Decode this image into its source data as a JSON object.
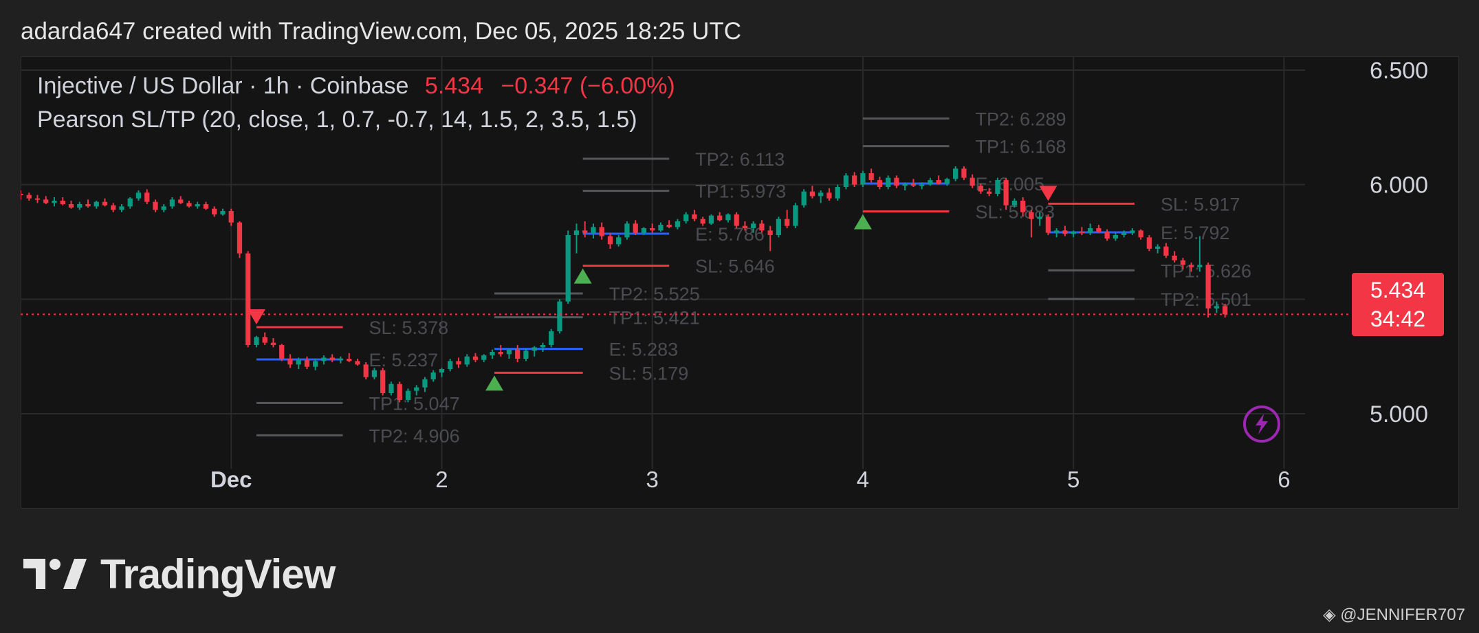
{
  "header": {
    "title": "adarda647 created with TradingView.com, Dec 05, 2025 18:25 UTC"
  },
  "legend": {
    "symbol": "Injective / US Dollar · 1h · Coinbase",
    "price": "5.434",
    "change": "−0.347 (−6.00%)",
    "indicator": "Pearson SL/TP (20, close, 1, 0.7, -0.7, 14, 1.5, 2, 3.5, 1.5)"
  },
  "price_badge": {
    "price": "5.434",
    "countdown": "34:42"
  },
  "brand": {
    "name": "TradingView"
  },
  "credit": {
    "text": "@JENNIFER707"
  },
  "colors": {
    "up": "#089981",
    "down": "#f23645",
    "entry": "#2962ff",
    "sl": "#f23645",
    "tp": "#55575d",
    "label": "#4a4c52",
    "current_price": "#f23645"
  },
  "chart_data": {
    "type": "candlestick",
    "x_axis": {
      "ticks": [
        "Dec",
        "2",
        "3",
        "4",
        "5",
        "6"
      ],
      "tick_positions_days": [
        1,
        2,
        3,
        4,
        5,
        6
      ]
    },
    "y_axis": {
      "ticks": [
        5.0,
        5.5,
        6.0,
        6.5
      ],
      "tick_labels": [
        "5.000",
        "5.500",
        "6.000",
        "6.500"
      ],
      "range": [
        4.76,
        6.56
      ],
      "side": "right"
    },
    "current_price": 5.434,
    "x_range_days": [
      0.0,
      6.1
    ],
    "candles": [
      [
        0.0,
        5.96,
        5.975,
        5.935,
        5.955
      ],
      [
        0.04,
        5.955,
        5.965,
        5.93,
        5.94
      ],
      [
        0.08,
        5.94,
        5.955,
        5.92,
        5.935
      ],
      [
        0.12,
        5.935,
        5.95,
        5.915,
        5.92
      ],
      [
        0.16,
        5.92,
        5.945,
        5.905,
        5.93
      ],
      [
        0.2,
        5.93,
        5.945,
        5.91,
        5.915
      ],
      [
        0.24,
        5.915,
        5.93,
        5.895,
        5.9
      ],
      [
        0.28,
        5.9,
        5.925,
        5.89,
        5.915
      ],
      [
        0.32,
        5.915,
        5.935,
        5.9,
        5.905
      ],
      [
        0.36,
        5.905,
        5.93,
        5.895,
        5.925
      ],
      [
        0.4,
        5.925,
        5.94,
        5.905,
        5.91
      ],
      [
        0.44,
        5.91,
        5.92,
        5.88,
        5.89
      ],
      [
        0.48,
        5.89,
        5.915,
        5.88,
        5.905
      ],
      [
        0.52,
        5.905,
        5.945,
        5.895,
        5.94
      ],
      [
        0.56,
        5.94,
        5.975,
        5.93,
        5.965
      ],
      [
        0.6,
        5.965,
        5.98,
        5.915,
        5.925
      ],
      [
        0.64,
        5.925,
        5.935,
        5.88,
        5.89
      ],
      [
        0.68,
        5.89,
        5.915,
        5.88,
        5.905
      ],
      [
        0.72,
        5.905,
        5.945,
        5.895,
        5.935
      ],
      [
        0.76,
        5.935,
        5.95,
        5.915,
        5.92
      ],
      [
        0.8,
        5.92,
        5.93,
        5.9,
        5.905
      ],
      [
        0.84,
        5.905,
        5.925,
        5.895,
        5.915
      ],
      [
        0.88,
        5.915,
        5.925,
        5.89,
        5.895
      ],
      [
        0.92,
        5.895,
        5.905,
        5.86,
        5.87
      ],
      [
        0.96,
        5.87,
        5.895,
        5.865,
        5.885
      ],
      [
        1.0,
        5.885,
        5.895,
        5.82,
        5.835
      ],
      [
        1.04,
        5.835,
        5.84,
        5.68,
        5.7
      ],
      [
        1.08,
        5.7,
        5.71,
        5.29,
        5.3
      ],
      [
        1.12,
        5.3,
        5.34,
        5.29,
        5.335
      ],
      [
        1.16,
        5.335,
        5.355,
        5.3,
        5.31
      ],
      [
        1.2,
        5.31,
        5.33,
        5.29,
        5.3
      ],
      [
        1.24,
        5.3,
        5.305,
        5.23,
        5.24
      ],
      [
        1.28,
        5.24,
        5.26,
        5.2,
        5.215
      ],
      [
        1.32,
        5.215,
        5.245,
        5.195,
        5.235
      ],
      [
        1.36,
        5.235,
        5.25,
        5.195,
        5.205
      ],
      [
        1.4,
        5.205,
        5.24,
        5.19,
        5.23
      ],
      [
        1.44,
        5.23,
        5.255,
        5.215,
        5.245
      ],
      [
        1.48,
        5.245,
        5.26,
        5.225,
        5.235
      ],
      [
        1.52,
        5.235,
        5.25,
        5.22,
        5.24
      ],
      [
        1.56,
        5.24,
        5.265,
        5.225,
        5.23
      ],
      [
        1.6,
        5.23,
        5.24,
        5.21,
        5.215
      ],
      [
        1.64,
        5.215,
        5.225,
        5.15,
        5.16
      ],
      [
        1.68,
        5.16,
        5.2,
        5.15,
        5.19
      ],
      [
        1.72,
        5.19,
        5.2,
        5.08,
        5.09
      ],
      [
        1.76,
        5.09,
        5.14,
        5.08,
        5.13
      ],
      [
        1.8,
        5.13,
        5.14,
        5.05,
        5.06
      ],
      [
        1.84,
        5.06,
        5.11,
        5.05,
        5.1
      ],
      [
        1.88,
        5.1,
        5.125,
        5.08,
        5.115
      ],
      [
        1.92,
        5.115,
        5.16,
        5.095,
        5.15
      ],
      [
        1.96,
        5.15,
        5.19,
        5.14,
        5.18
      ],
      [
        2.0,
        5.18,
        5.2,
        5.16,
        5.195
      ],
      [
        2.04,
        5.195,
        5.24,
        5.185,
        5.23
      ],
      [
        2.08,
        5.23,
        5.245,
        5.2,
        5.215
      ],
      [
        2.12,
        5.215,
        5.26,
        5.205,
        5.25
      ],
      [
        2.16,
        5.25,
        5.265,
        5.225,
        5.235
      ],
      [
        2.2,
        5.235,
        5.26,
        5.225,
        5.255
      ],
      [
        2.24,
        5.255,
        5.28,
        5.24,
        5.27
      ],
      [
        2.28,
        5.27,
        5.3,
        5.25,
        5.26
      ],
      [
        2.32,
        5.26,
        5.285,
        5.24,
        5.28
      ],
      [
        2.36,
        5.28,
        5.3,
        5.225,
        5.24
      ],
      [
        2.4,
        5.24,
        5.285,
        5.23,
        5.275
      ],
      [
        2.44,
        5.275,
        5.295,
        5.25,
        5.29
      ],
      [
        2.48,
        5.29,
        5.31,
        5.27,
        5.3
      ],
      [
        2.52,
        5.3,
        5.37,
        5.29,
        5.36
      ],
      [
        2.56,
        5.36,
        5.5,
        5.35,
        5.49
      ],
      [
        2.6,
        5.49,
        5.8,
        5.48,
        5.78
      ],
      [
        2.64,
        5.78,
        5.83,
        5.7,
        5.8
      ],
      [
        2.68,
        5.8,
        5.84,
        5.77,
        5.79
      ],
      [
        2.72,
        5.79,
        5.83,
        5.765,
        5.815
      ],
      [
        2.76,
        5.815,
        5.835,
        5.76,
        5.775
      ],
      [
        2.8,
        5.775,
        5.79,
        5.72,
        5.74
      ],
      [
        2.84,
        5.74,
        5.78,
        5.73,
        5.77
      ],
      [
        2.88,
        5.77,
        5.84,
        5.76,
        5.83
      ],
      [
        2.92,
        5.83,
        5.845,
        5.78,
        5.79
      ],
      [
        2.96,
        5.79,
        5.815,
        5.78,
        5.81
      ],
      [
        3.0,
        5.81,
        5.83,
        5.79,
        5.8
      ],
      [
        3.04,
        5.8,
        5.835,
        5.795,
        5.825
      ],
      [
        3.08,
        5.825,
        5.845,
        5.81,
        5.815
      ],
      [
        3.12,
        5.815,
        5.85,
        5.805,
        5.84
      ],
      [
        3.16,
        5.84,
        5.88,
        5.83,
        5.87
      ],
      [
        3.2,
        5.87,
        5.89,
        5.84,
        5.85
      ],
      [
        3.24,
        5.85,
        5.86,
        5.82,
        5.83
      ],
      [
        3.28,
        5.83,
        5.87,
        5.825,
        5.865
      ],
      [
        3.32,
        5.865,
        5.88,
        5.84,
        5.845
      ],
      [
        3.36,
        5.845,
        5.875,
        5.835,
        5.87
      ],
      [
        3.4,
        5.87,
        5.88,
        5.81,
        5.82
      ],
      [
        3.44,
        5.82,
        5.84,
        5.8,
        5.81
      ],
      [
        3.48,
        5.81,
        5.84,
        5.79,
        5.83
      ],
      [
        3.52,
        5.83,
        5.845,
        5.79,
        5.8
      ],
      [
        3.56,
        5.8,
        5.82,
        5.71,
        5.78
      ],
      [
        3.6,
        5.78,
        5.86,
        5.77,
        5.85
      ],
      [
        3.64,
        5.85,
        5.89,
        5.81,
        5.82
      ],
      [
        3.68,
        5.82,
        5.92,
        5.81,
        5.91
      ],
      [
        3.72,
        5.91,
        5.98,
        5.9,
        5.97
      ],
      [
        3.76,
        5.97,
        5.995,
        5.94,
        5.95
      ],
      [
        3.8,
        5.95,
        5.975,
        5.92,
        5.965
      ],
      [
        3.84,
        5.965,
        5.985,
        5.93,
        5.94
      ],
      [
        3.88,
        5.94,
        6.0,
        5.93,
        5.99
      ],
      [
        3.92,
        5.99,
        6.05,
        5.98,
        6.04
      ],
      [
        3.96,
        6.04,
        6.055,
        5.99,
        6.0
      ],
      [
        4.0,
        6.0,
        6.06,
        5.99,
        6.05
      ],
      [
        4.04,
        6.05,
        6.07,
        6.01,
        6.02
      ],
      [
        4.08,
        6.02,
        6.035,
        5.98,
        5.99
      ],
      [
        4.12,
        5.99,
        6.04,
        5.98,
        6.03
      ],
      [
        4.16,
        6.03,
        6.04,
        5.985,
        5.995
      ],
      [
        4.2,
        5.995,
        6.01,
        5.975,
        6.005
      ],
      [
        4.24,
        6.005,
        6.025,
        5.99,
        5.995
      ],
      [
        4.28,
        5.995,
        6.01,
        5.98,
        6.0
      ],
      [
        4.32,
        6.0,
        6.03,
        5.995,
        6.02
      ],
      [
        4.36,
        6.02,
        6.04,
        6.0,
        6.005
      ],
      [
        4.4,
        6.005,
        6.03,
        5.995,
        6.025
      ],
      [
        4.44,
        6.025,
        6.08,
        6.015,
        6.07
      ],
      [
        4.48,
        6.07,
        6.08,
        6.02,
        6.03
      ],
      [
        4.52,
        6.03,
        6.045,
        5.985,
        5.995
      ],
      [
        4.56,
        5.995,
        6.005,
        5.96,
        5.97
      ],
      [
        4.6,
        5.97,
        5.985,
        5.95,
        5.96
      ],
      [
        4.64,
        5.96,
        6.03,
        5.95,
        6.02
      ],
      [
        4.68,
        6.02,
        6.03,
        5.89,
        5.91
      ],
      [
        4.72,
        5.91,
        5.94,
        5.9,
        5.93
      ],
      [
        4.76,
        5.93,
        5.945,
        5.86,
        5.88
      ],
      [
        4.8,
        5.88,
        5.89,
        5.77,
        5.85
      ],
      [
        4.84,
        5.85,
        5.88,
        5.82,
        5.86
      ],
      [
        4.88,
        5.86,
        5.87,
        5.78,
        5.79
      ],
      [
        4.92,
        5.79,
        5.81,
        5.77,
        5.8
      ],
      [
        4.96,
        5.8,
        5.82,
        5.775,
        5.785
      ],
      [
        5.0,
        5.785,
        5.8,
        5.77,
        5.795
      ],
      [
        5.04,
        5.795,
        5.815,
        5.78,
        5.79
      ],
      [
        5.08,
        5.79,
        5.83,
        5.78,
        5.81
      ],
      [
        5.12,
        5.81,
        5.825,
        5.79,
        5.795
      ],
      [
        5.16,
        5.795,
        5.805,
        5.755,
        5.765
      ],
      [
        5.2,
        5.765,
        5.79,
        5.755,
        5.78
      ],
      [
        5.24,
        5.78,
        5.8,
        5.77,
        5.79
      ],
      [
        5.28,
        5.79,
        5.81,
        5.78,
        5.8
      ],
      [
        5.32,
        5.8,
        5.805,
        5.76,
        5.77
      ],
      [
        5.36,
        5.77,
        5.78,
        5.71,
        5.72
      ],
      [
        5.4,
        5.72,
        5.74,
        5.7,
        5.73
      ],
      [
        5.44,
        5.73,
        5.745,
        5.68,
        5.69
      ],
      [
        5.48,
        5.69,
        5.71,
        5.66,
        5.67
      ],
      [
        5.52,
        5.67,
        5.68,
        5.63,
        5.65
      ],
      [
        5.56,
        5.65,
        5.66,
        5.62,
        5.64
      ],
      [
        5.6,
        5.64,
        5.775,
        5.62,
        5.65
      ],
      [
        5.64,
        5.65,
        5.66,
        5.42,
        5.46
      ],
      [
        5.68,
        5.46,
        5.49,
        5.44,
        5.47
      ],
      [
        5.72,
        5.47,
        5.48,
        5.42,
        5.434
      ]
    ],
    "signals": [
      {
        "kind": "sell",
        "x_start": 1.12,
        "x_end": 1.53,
        "marker": "down",
        "marker_x": 1.12,
        "levels": [
          {
            "name": "SL",
            "value": 5.378,
            "label": "SL: 5.378"
          },
          {
            "name": "E",
            "value": 5.237,
            "label": "E: 5.237"
          },
          {
            "name": "TP1",
            "value": 5.047,
            "label": "TP1: 5.047"
          },
          {
            "name": "TP2",
            "value": 4.906,
            "label": "TP2: 4.906"
          }
        ]
      },
      {
        "kind": "buy",
        "x_start": 2.25,
        "x_end": 2.67,
        "marker": "up",
        "marker_x": 2.25,
        "levels": [
          {
            "name": "TP2",
            "value": 5.525,
            "label": "TP2: 5.525"
          },
          {
            "name": "TP1",
            "value": 5.421,
            "label": "TP1: 5.421"
          },
          {
            "name": "E",
            "value": 5.283,
            "label": "E: 5.283"
          },
          {
            "name": "SL",
            "value": 5.179,
            "label": "SL: 5.179"
          }
        ]
      },
      {
        "kind": "buy",
        "x_start": 2.67,
        "x_end": 3.08,
        "marker": "up",
        "marker_x": 2.67,
        "levels": [
          {
            "name": "TP2",
            "value": 6.113,
            "label": "TP2: 6.113"
          },
          {
            "name": "TP1",
            "value": 5.973,
            "label": "TP1: 5.973"
          },
          {
            "name": "E",
            "value": 5.786,
            "label": "E: 5.786"
          },
          {
            "name": "SL",
            "value": 5.646,
            "label": "SL: 5.646"
          }
        ]
      },
      {
        "kind": "buy",
        "x_start": 4.0,
        "x_end": 4.41,
        "marker": "up",
        "marker_x": 4.0,
        "levels": [
          {
            "name": "TP2",
            "value": 6.289,
            "label": "TP2: 6.289"
          },
          {
            "name": "TP1",
            "value": 6.168,
            "label": "TP1: 6.168"
          },
          {
            "name": "E",
            "value": 6.005,
            "label": "E: 6.005"
          },
          {
            "name": "SL",
            "value": 5.883,
            "label": "SL: 5.883"
          }
        ]
      },
      {
        "kind": "sell",
        "x_start": 4.88,
        "x_end": 5.29,
        "marker": "down",
        "marker_x": 4.88,
        "levels": [
          {
            "name": "SL",
            "value": 5.917,
            "label": "SL: 5.917"
          },
          {
            "name": "E",
            "value": 5.792,
            "label": "E: 5.792"
          },
          {
            "name": "TP1",
            "value": 5.626,
            "label": "TP1: 5.626"
          },
          {
            "name": "TP2",
            "value": 5.501,
            "label": "TP2: 5.501"
          }
        ]
      }
    ]
  }
}
